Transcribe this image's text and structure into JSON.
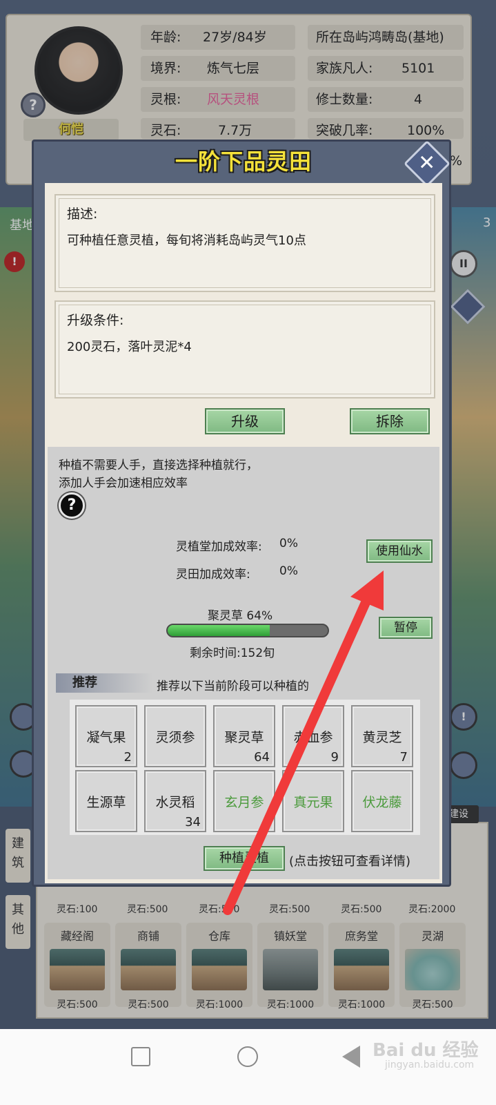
{
  "profile": {
    "name": "何恺",
    "help_glyph": "?",
    "stats": [
      {
        "label": "年龄:",
        "value": "27岁/84岁"
      },
      {
        "label": "境界:",
        "value": "炼气七层"
      },
      {
        "label": "灵根:",
        "value": "风天灵根"
      },
      {
        "label": "灵石:",
        "value": "7.7万"
      },
      {
        "label": "所在岛屿",
        "value": "鸿畴岛(基地)"
      },
      {
        "label": "家族凡人:",
        "value": "5101"
      },
      {
        "label": "修士数量:",
        "value": "4"
      },
      {
        "label": "突破几率:",
        "value": "100%"
      }
    ],
    "partial_right": "%"
  },
  "map": {
    "left_label": "基地",
    "right_label": "3",
    "jianshe": "建设"
  },
  "side_tabs": [
    "建筑",
    "其他"
  ],
  "buildings": {
    "top_costs": [
      "灵石:100",
      "灵石:500",
      "灵石:500",
      "灵石:500",
      "灵石:500",
      "灵石:2000"
    ],
    "items": [
      {
        "name": "藏经阁",
        "cost": "灵石:500"
      },
      {
        "name": "商铺",
        "cost": "灵石:500"
      },
      {
        "name": "仓库",
        "cost": "灵石:1000"
      },
      {
        "name": "镇妖堂",
        "cost": "灵石:1000"
      },
      {
        "name": "庶务堂",
        "cost": "灵石:1000"
      },
      {
        "name": "灵湖",
        "cost": "灵石:500"
      }
    ]
  },
  "dialog": {
    "title": "一阶下品灵田",
    "close": "✕",
    "description_heading": "描述:",
    "description_text": "可种植任意灵植，每旬将消耗岛屿灵气10点",
    "upgrade_heading": "升级条件:",
    "upgrade_text": "200灵石，落叶灵泥*4",
    "upgrade_button": "升级",
    "demolish_button": "拆除",
    "info_line1": "种植不需要人手，直接选择种植就行，",
    "info_line2": "添加人手会加速相应效率",
    "help_glyph": "?",
    "hall_bonus_label": "灵植堂加成效率:",
    "hall_bonus_value": "0%",
    "field_bonus_label": "灵田加成效率:",
    "field_bonus_value": "0%",
    "use_water_button": "使用仙水",
    "crop_label": "聚灵草 64%",
    "progress": 0.64,
    "remaining": "剩余时间:152旬",
    "pause_button": "暂停",
    "recommend_tag": "推荐",
    "recommend_text": "推荐以下当前阶段可以种植的",
    "seeds": [
      {
        "name": "凝气果",
        "count": "2",
        "locked": false
      },
      {
        "name": "灵须参",
        "count": "",
        "locked": false
      },
      {
        "name": "聚灵草",
        "count": "64",
        "locked": false
      },
      {
        "name": "赤血参",
        "count": "9",
        "locked": false
      },
      {
        "name": "黄灵芝",
        "count": "7",
        "locked": false
      },
      {
        "name": "生源草",
        "count": "",
        "locked": false
      },
      {
        "name": "水灵稻",
        "count": "34",
        "locked": false
      },
      {
        "name": "玄月参",
        "count": "",
        "locked": true
      },
      {
        "name": "真元果",
        "count": "",
        "locked": true
      },
      {
        "name": "伏龙藤",
        "count": "",
        "locked": true
      }
    ],
    "plant_button": "种植灵植",
    "plant_hint": "(点击按钮可查看详情)"
  },
  "watermark": {
    "text": "Bai du 经验",
    "sub": "jingyan.baidu.com"
  },
  "colors": {
    "accent_green": "#7fb982",
    "title_yellow": "#f5e23a",
    "arrow_red": "#f03a3a",
    "locked_green": "#4b9a3c"
  }
}
